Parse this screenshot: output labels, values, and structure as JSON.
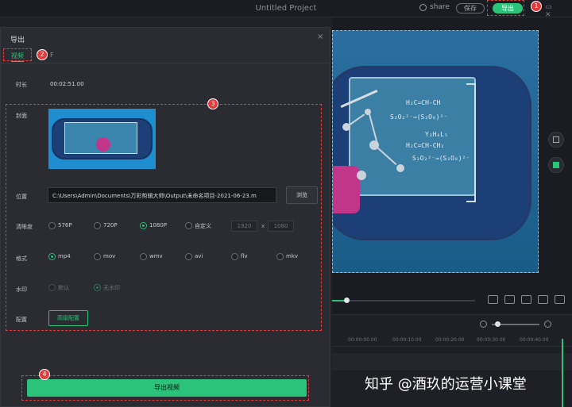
{
  "window": {
    "title": "Untitled Project",
    "share": "share",
    "save_label": "保存",
    "export_label": "导出",
    "win_controls": "▭ ✕"
  },
  "dialog": {
    "title": "导出",
    "close": "×",
    "tab_video": "视频",
    "tab_other": "F",
    "duration_label": "时长",
    "duration_value": "00:02:51.00",
    "cover_label": "封面",
    "location_label": "位置",
    "location_value": "C:\\Users\\Admin\\Documents\\万彩剪辑大师\\Output\\未命名项目-2021-06-23.m",
    "browse_label": "浏览",
    "resolution_label": "清晰度",
    "resolutions": [
      {
        "label": "576P",
        "selected": false
      },
      {
        "label": "720P",
        "selected": false
      },
      {
        "label": "1080P",
        "selected": true
      },
      {
        "label": "自定义",
        "selected": false
      }
    ],
    "custom_width": "1920",
    "custom_x": "x",
    "custom_height": "1080",
    "format_label": "格式",
    "formats": [
      {
        "label": "mp4",
        "selected": true
      },
      {
        "label": "mov",
        "selected": false
      },
      {
        "label": "wmv",
        "selected": false
      },
      {
        "label": "avi",
        "selected": false
      },
      {
        "label": "flv",
        "selected": false
      },
      {
        "label": "mkv",
        "selected": false
      }
    ],
    "watermark_label": "水印",
    "watermark_options": [
      {
        "label": "默认",
        "selected": false
      },
      {
        "label": "无水印",
        "selected": true
      }
    ],
    "config_label": "配置",
    "advanced_label": "高级配置",
    "export_label": "导出视频"
  },
  "preview": {
    "formulas": [
      "H₂C=CH-CH",
      "S₂O₂²⁻⇒(S₂O₈)²⁻",
      "Y₂H₄L₅",
      "H₂C=CH-CH₂",
      "S₂O₂²⁻⇒(S₂O₈)²⁻"
    ]
  },
  "timeline": {
    "ticks": [
      "00:00:00.00",
      "00:00:10.00",
      "00:00:20.00",
      "00:00:30.00",
      "00:00:40.00"
    ]
  },
  "annotations": [
    "1",
    "2",
    "3",
    "4"
  ],
  "watermark_text": "知乎 @酒玖的运营小课堂",
  "colors": {
    "accent": "#2bc37a",
    "annotation": "#e63a3a"
  }
}
